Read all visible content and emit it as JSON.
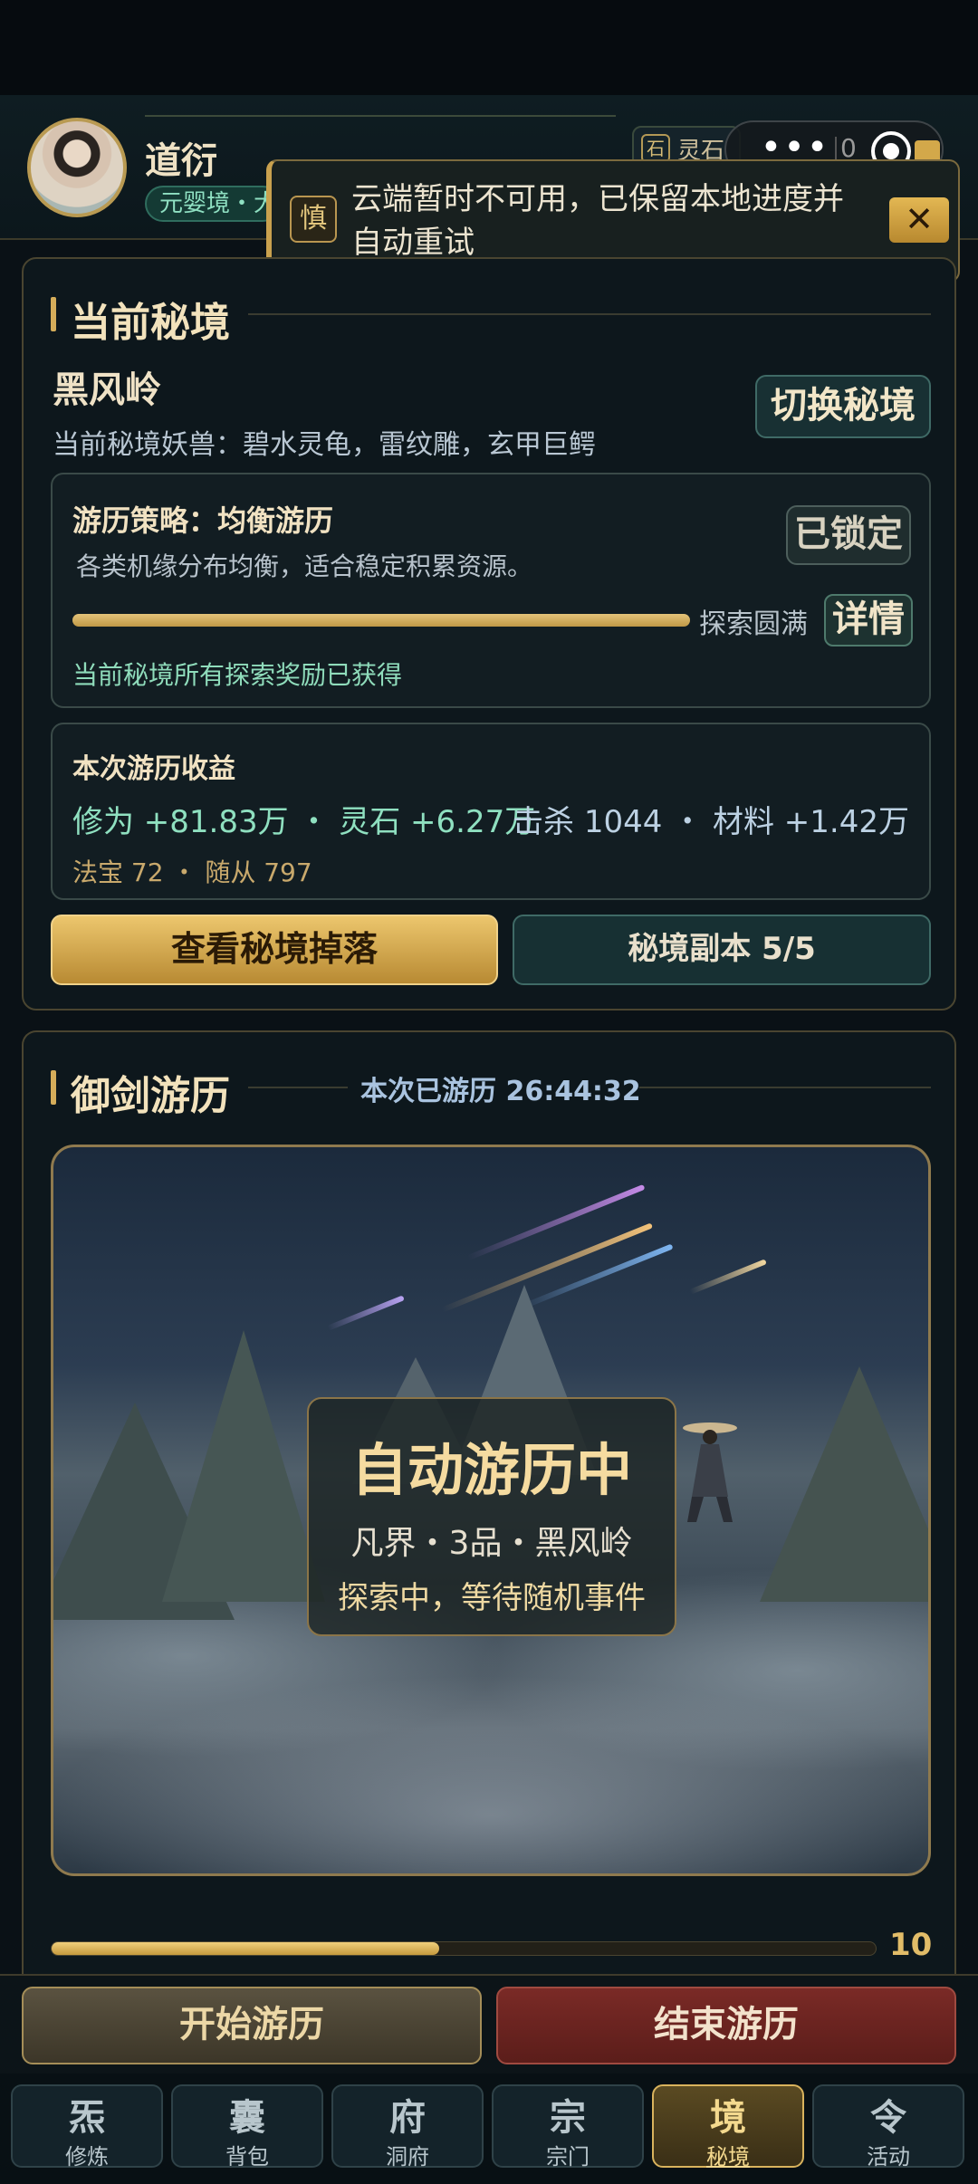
{
  "header": {
    "player_name": "道衍",
    "realm_badge": "元婴境・大",
    "stone_icon": "石",
    "stone_label": "灵石",
    "capsule_dots": "•••",
    "capsule_count": "0"
  },
  "toast": {
    "icon": "慎",
    "message": "云端暂时不可用，已保留本地进度并自动重试",
    "close": "✕"
  },
  "current_realm": {
    "section_title": "当前秘境",
    "name": "黑风岭",
    "beasts": "当前秘境妖兽：碧水灵龟，雷纹雕，玄甲巨鳄",
    "switch_button": "切换秘境",
    "strategy_title": "游历策略：均衡游历",
    "strategy_desc": "各类机缘分布均衡，适合稳定积累资源。",
    "locked_button": "已锁定",
    "explore_progress": 1.0,
    "explore_label": "探索圆满",
    "detail_button": "详情",
    "strategy_note": "当前秘境所有探索奖励已获得",
    "earnings_title": "本次游历收益",
    "earnings_left": "修为 +81.83万 ・ 灵石 +6.27万",
    "earnings_right": "击杀 1044 ・ 材料 +1.42万",
    "earnings_small": "法宝 72 ・ 随从 797",
    "drop_button": "查看秘境掉落",
    "dungeon_button": "秘境副本 5/5"
  },
  "sword_travel": {
    "section_title": "御剑游历",
    "elapsed": "本次已游历 26:44:32",
    "overlay_title": "自动游历中",
    "overlay_sub": "凡界・3品・黑风岭",
    "overlay_status": "探索中，等待随机事件",
    "progress": 0.47,
    "count": "10"
  },
  "actions": {
    "start": "开始游历",
    "end": "结束游历"
  },
  "tabs": [
    {
      "glyph": "炁",
      "label": "修炼"
    },
    {
      "glyph": "囊",
      "label": "背包"
    },
    {
      "glyph": "府",
      "label": "洞府"
    },
    {
      "glyph": "宗",
      "label": "宗门"
    },
    {
      "glyph": "境",
      "label": "秘境"
    },
    {
      "glyph": "令",
      "label": "活动"
    }
  ],
  "colors": {
    "accent_gold": "#d5ad5a",
    "teal_text": "#8fe0c0",
    "end_red": "#7a2a26"
  }
}
